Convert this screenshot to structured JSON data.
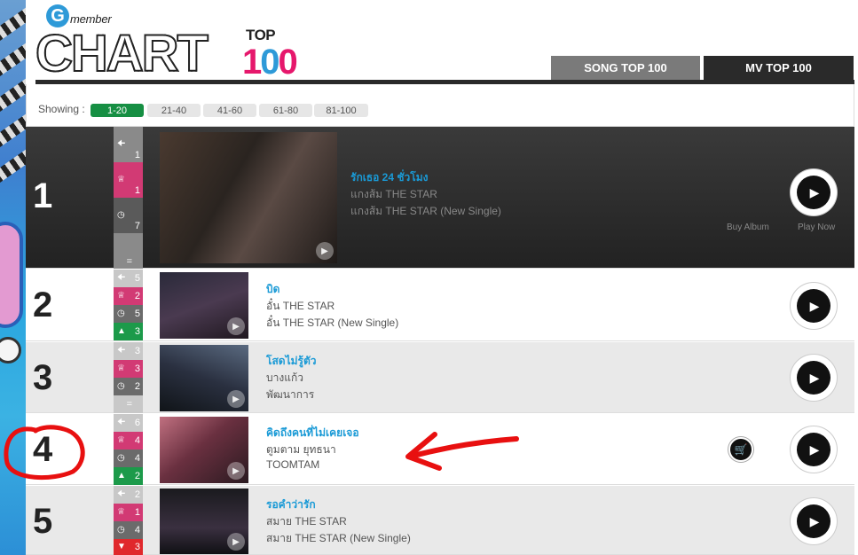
{
  "logo": {
    "brand_g": "G",
    "brand_rest": "member",
    "chart": "CHART",
    "top": "TOP",
    "hundred": [
      "1",
      "0",
      "0"
    ]
  },
  "tabs": [
    {
      "label": "SONG TOP 100",
      "selected": false
    },
    {
      "label": "MV TOP 100",
      "selected": true
    }
  ],
  "showing": {
    "label": "Showing :",
    "pages": [
      "1-20",
      "21-40",
      "41-60",
      "61-80",
      "81-100"
    ],
    "active": "1-20"
  },
  "icons": {
    "prev": "arrow-left-icon",
    "peak": "crown-icon",
    "weeks": "clock-icon",
    "up": "triangle-up-icon",
    "down": "triangle-down-icon",
    "same": "equals-icon",
    "play": "play-icon",
    "cart": "cart-icon"
  },
  "colors": {
    "accent": "#1a9ad6",
    "peak": "#d23a74",
    "up": "#1c9a4a",
    "down": "#e0282c",
    "active_page": "#168f43"
  },
  "rows": [
    {
      "rank": "1",
      "prev": "1",
      "peak": "1",
      "weeks": "7",
      "change_type": "same",
      "change": "=",
      "title": "รักเธอ 24 ชั่วโมง",
      "artist": "แกงส้ม THE STAR",
      "album": "แกงส้ม THE STAR (New Single)",
      "buy_label": "Buy Album",
      "play_label": "Play Now"
    },
    {
      "rank": "2",
      "prev": "5",
      "peak": "2",
      "weeks": "5",
      "change_type": "up",
      "change": "3",
      "title": "บิด",
      "artist": "อั๋น THE STAR",
      "album": "อั๋น THE STAR (New Single)"
    },
    {
      "rank": "3",
      "prev": "3",
      "peak": "3",
      "weeks": "2",
      "change_type": "same",
      "change": "=",
      "title": "โสดไม่รู้ตัว",
      "artist": "บางแก้ว",
      "album": "พัฒนาการ"
    },
    {
      "rank": "4",
      "prev": "6",
      "peak": "4",
      "weeks": "4",
      "change_type": "up",
      "change": "2",
      "title": "คิดถึงคนที่ไม่เคยเจอ",
      "artist": "ตูมตาม ยุทธนา",
      "album": "TOOMTAM"
    },
    {
      "rank": "5",
      "prev": "2",
      "peak": "1",
      "weeks": "4",
      "change_type": "down",
      "change": "3",
      "title": "รอคำว่ารัก",
      "artist": "สมาย THE STAR",
      "album": "สมาย THE STAR (New Single)"
    }
  ]
}
